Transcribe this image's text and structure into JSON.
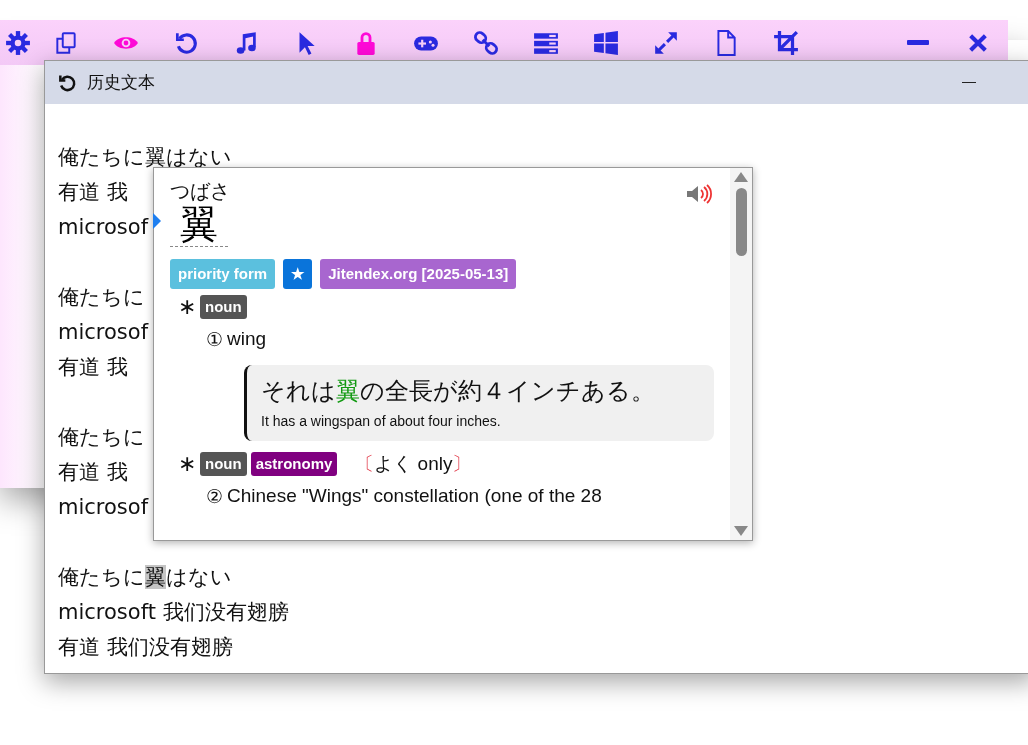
{
  "toolbar": [
    {
      "kind": "gear",
      "on": false
    },
    {
      "kind": "copy",
      "on": false
    },
    {
      "kind": "eye",
      "on": true
    },
    {
      "kind": "undo",
      "on": false
    },
    {
      "kind": "music",
      "on": false
    },
    {
      "kind": "cursor",
      "on": false
    },
    {
      "kind": "lock",
      "on": true
    },
    {
      "kind": "gamepad",
      "on": false
    },
    {
      "kind": "link",
      "on": false
    },
    {
      "kind": "list",
      "on": false
    },
    {
      "kind": "windows",
      "on": false
    },
    {
      "kind": "expand",
      "on": false
    },
    {
      "kind": "document",
      "on": false
    },
    {
      "kind": "crop",
      "on": false
    }
  ],
  "window": {
    "title": "历史文本"
  },
  "paragraphs": [
    [
      {
        "segments": [
          {
            "text": "俺たちに翼はない",
            "highlighted": false
          }
        ]
      },
      {
        "segments": [
          {
            "text": "有道 我",
            "highlighted": false
          }
        ]
      },
      {
        "segments": [
          {
            "text": "microsof",
            "highlighted": false
          }
        ]
      }
    ],
    [
      {
        "segments": [
          {
            "text": "俺たちに",
            "highlighted": false
          }
        ]
      },
      {
        "segments": [
          {
            "text": "microsof",
            "highlighted": false
          }
        ]
      },
      {
        "segments": [
          {
            "text": "有道 我",
            "highlighted": false
          }
        ]
      }
    ],
    [
      {
        "segments": [
          {
            "text": "俺たちに",
            "highlighted": false
          }
        ]
      },
      {
        "segments": [
          {
            "text": "有道 我",
            "highlighted": false
          }
        ]
      },
      {
        "segments": [
          {
            "text": "microsof",
            "highlighted": false
          }
        ]
      }
    ],
    [
      {
        "segments": [
          {
            "text": "俺たちに",
            "highlighted": false
          },
          {
            "text": "翼",
            "highlighted": true
          },
          {
            "text": "はない",
            "highlighted": false
          }
        ]
      },
      {
        "segments": [
          {
            "text": "microsoft 我们没有翅膀",
            "highlighted": false
          }
        ]
      },
      {
        "segments": [
          {
            "text": "有道 我们没有翅膀",
            "highlighted": false
          }
        ]
      }
    ]
  ],
  "popup": {
    "reading": "つばさ",
    "headword": "翼",
    "tags": [
      {
        "text": "priority form",
        "color": "#5bc0de"
      },
      {
        "text": "★",
        "color": "#0a74da"
      },
      {
        "text": "Jitendex.org [2025-05-13]",
        "color": "#a866cf"
      }
    ],
    "groups": [
      {
        "marker": "∗",
        "tags": [
          {
            "text": "noun",
            "color": "#555555"
          }
        ],
        "senses": [
          {
            "number": "①",
            "gloss": "wing",
            "examples": [
              {
                "sentence": [
                  {
                    "text": "それは",
                    "term": false
                  },
                  {
                    "text": "翼",
                    "term": true
                  },
                  {
                    "text": "の全長が約４インチある。",
                    "term": false
                  }
                ],
                "translation": "It has a wingspan of about four inches."
              }
            ]
          }
        ]
      },
      {
        "marker": "∗",
        "tags": [
          {
            "text": "noun",
            "color": "#555555"
          },
          {
            "text": "astronomy",
            "color": "#800080"
          }
        ],
        "note": "〔よく only〕",
        "senses": [
          {
            "number": "②",
            "gloss": "Chinese \"Wings\" constellation (one of the 28"
          }
        ]
      }
    ]
  }
}
